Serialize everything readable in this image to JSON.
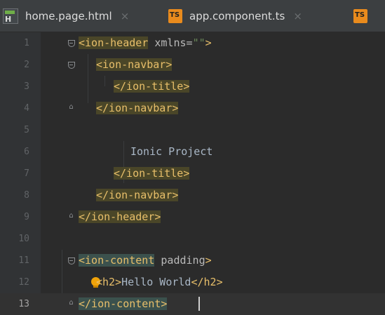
{
  "tabs": [
    {
      "label": "home.page.html",
      "icon": "html-file-icon",
      "close": "×"
    },
    {
      "label": "app.component.ts",
      "icon": "typescript-file-icon",
      "close": "×"
    },
    {
      "label": "",
      "icon": "typescript-file-icon"
    }
  ],
  "editor": {
    "lines": [
      {
        "number": "1",
        "t1": "<ion-header",
        "a1": " xmlns=",
        "s1": "\"\"",
        "t2": ">"
      },
      {
        "number": "2",
        "t1": "<ion-navbar>"
      },
      {
        "number": "3",
        "t1": "</ion-title>"
      },
      {
        "number": "4",
        "t1": "</ion-navbar>"
      },
      {
        "number": "5"
      },
      {
        "number": "6",
        "text": "Ionic Project"
      },
      {
        "number": "7",
        "t1": "</ion-title>"
      },
      {
        "number": "8",
        "t1": "</ion-navbar>"
      },
      {
        "number": "9",
        "t1": "</ion-header>"
      },
      {
        "number": "10"
      },
      {
        "number": "11",
        "t1": "<ion-content",
        "a1": " padding",
        "t2": ">"
      },
      {
        "number": "12",
        "t1": "<h2>",
        "text": "Hello World",
        "t2": "</h2>"
      },
      {
        "number": "13",
        "t1": "</ion-content>"
      }
    ]
  },
  "colors": {
    "background": "#2b2b2b",
    "tag": "#e8bf6a",
    "text": "#a9b7c6",
    "string": "#6a8759",
    "highlight": "#4a4628"
  }
}
